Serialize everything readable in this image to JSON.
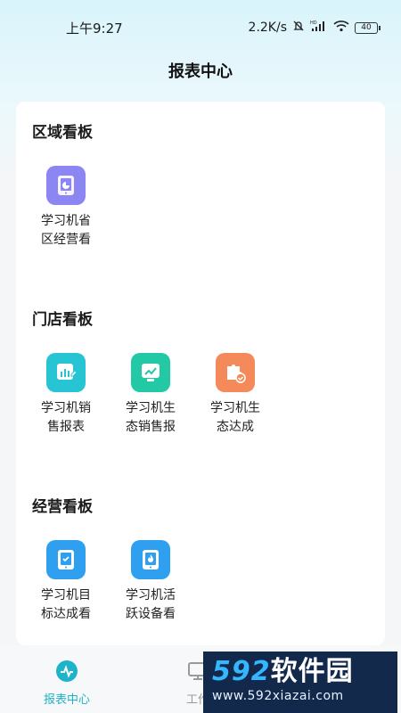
{
  "status_bar": {
    "time": "上午9:27",
    "network_speed": "2.2K/s",
    "battery_level": "40",
    "icons": [
      "mute-bell-icon",
      "hd-signal-icon",
      "wifi-icon",
      "battery-icon"
    ]
  },
  "header": {
    "title": "报表中心"
  },
  "sections": [
    {
      "title": "区域看板",
      "items": [
        {
          "label": "学习机省区经营看",
          "icon": "tablet-pie-chart-icon",
          "color": "#8b86f2"
        }
      ]
    },
    {
      "title": "门店看板",
      "items": [
        {
          "label": "学习机销售报表",
          "icon": "bar-chart-edit-icon",
          "color": "#27c4d3"
        },
        {
          "label": "学习机生态销售报",
          "icon": "trend-chart-icon",
          "color": "#22c9a4"
        },
        {
          "label": "学习机生态达成",
          "icon": "puzzle-check-icon",
          "color": "#f48a5a"
        }
      ]
    },
    {
      "title": "经营看板",
      "items": [
        {
          "label": "学习机目标达成看",
          "icon": "tablet-check-icon",
          "color": "#2f9ff0"
        },
        {
          "label": "学习机活跃设备看",
          "icon": "tablet-flame-icon",
          "color": "#2f9ff0"
        }
      ]
    }
  ],
  "tab_bar": {
    "tabs": [
      {
        "label": "报表中心",
        "active": true,
        "icon": "pulse-chart-icon"
      },
      {
        "label": "工作",
        "active": false,
        "icon": "monitor-icon"
      }
    ],
    "active_color": "#1db3c9"
  },
  "watermark": {
    "number": "592",
    "text": "软件园",
    "url": "www.592xiazai.com"
  }
}
